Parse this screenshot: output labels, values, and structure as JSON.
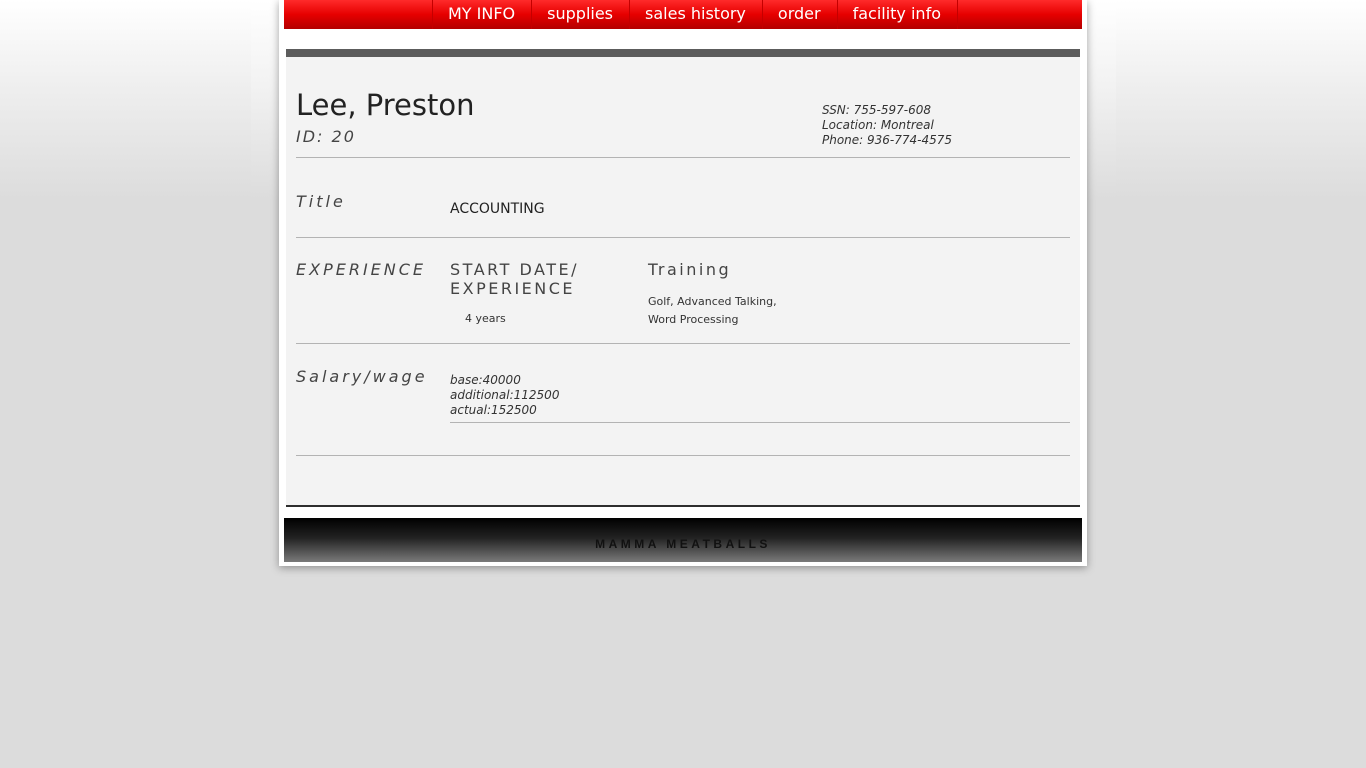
{
  "nav": {
    "items": [
      {
        "label": "MY INFO"
      },
      {
        "label": "supplies"
      },
      {
        "label": "sales history"
      },
      {
        "label": "order"
      },
      {
        "label": "facility info"
      }
    ]
  },
  "employee": {
    "name": "Lee, Preston",
    "id_label": "ID: 20",
    "ssn": "SSN: 755-597-608",
    "location": "Location: Montreal",
    "phone": "Phone: 936-774-4575"
  },
  "title_section": {
    "label": "Title",
    "value": "ACCOUNTING"
  },
  "experience_section": {
    "label": "EXPERIENCE",
    "start_heading": "START DATE/ EXPERIENCE",
    "years": "4 years",
    "training_heading": "Training",
    "training_list": "Golf, Advanced Talking, Word Processing"
  },
  "salary_section": {
    "label": "Salary/wage",
    "base": "base:40000",
    "additional": "additional:112500",
    "actual": "actual:152500"
  },
  "footer": {
    "text": "MAMMA MEATBALLS"
  },
  "colors": {
    "nav_red": "#e60000",
    "content_bg": "#f3f3f3",
    "content_top_bar": "#5c5c5c",
    "page_bg": "#dcdcdc"
  }
}
